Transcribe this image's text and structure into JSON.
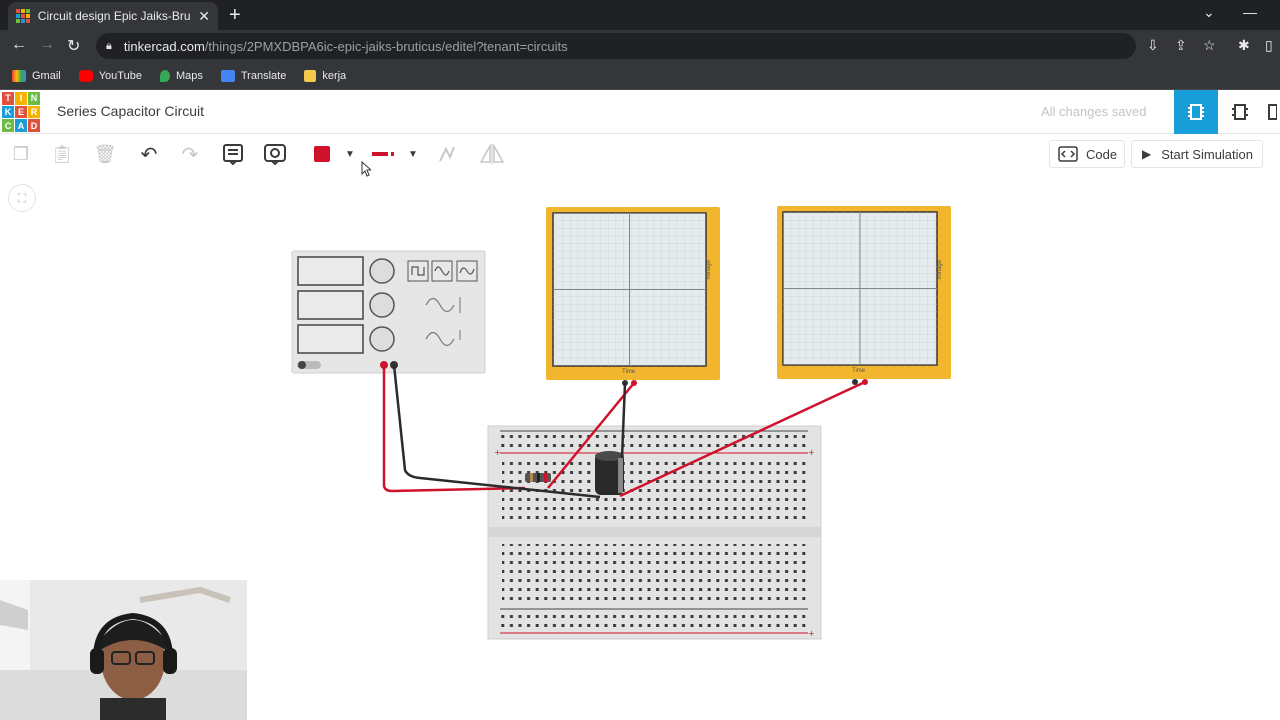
{
  "browser": {
    "tab_title": "Circuit design Epic Jaiks-Bruticus",
    "url_host": "tinkercad.com",
    "url_path": "/things/2PMXDBPA6ic-epic-jaiks-bruticus/editel?tenant=circuits",
    "bookmarks": [
      {
        "label": "Gmail",
        "icon": "gmail-icon"
      },
      {
        "label": "YouTube",
        "icon": "youtube-icon"
      },
      {
        "label": "Maps",
        "icon": "maps-icon"
      },
      {
        "label": "Translate",
        "icon": "translate-icon"
      },
      {
        "label": "kerja",
        "icon": "folder-icon"
      }
    ]
  },
  "app": {
    "logo_letters": [
      "T",
      "I",
      "N",
      "K",
      "E",
      "R",
      "C",
      "A",
      "D"
    ],
    "project_title": "Series Capacitor Circuit",
    "save_status": "All changes saved"
  },
  "toolbar": {
    "code_label": "Code",
    "simulate_label": "Start Simulation",
    "wire_color": "#d0112b"
  },
  "oscilloscopes": [
    {
      "side_label": "Voltage",
      "bottom_label": "Time"
    },
    {
      "side_label": "Voltage",
      "bottom_label": "Time"
    }
  ],
  "colors": {
    "accent": "#1a9ed9",
    "scope_frame": "#f1b62e",
    "wire_red": "#d0112b",
    "wire_black": "#2b2b2b"
  }
}
